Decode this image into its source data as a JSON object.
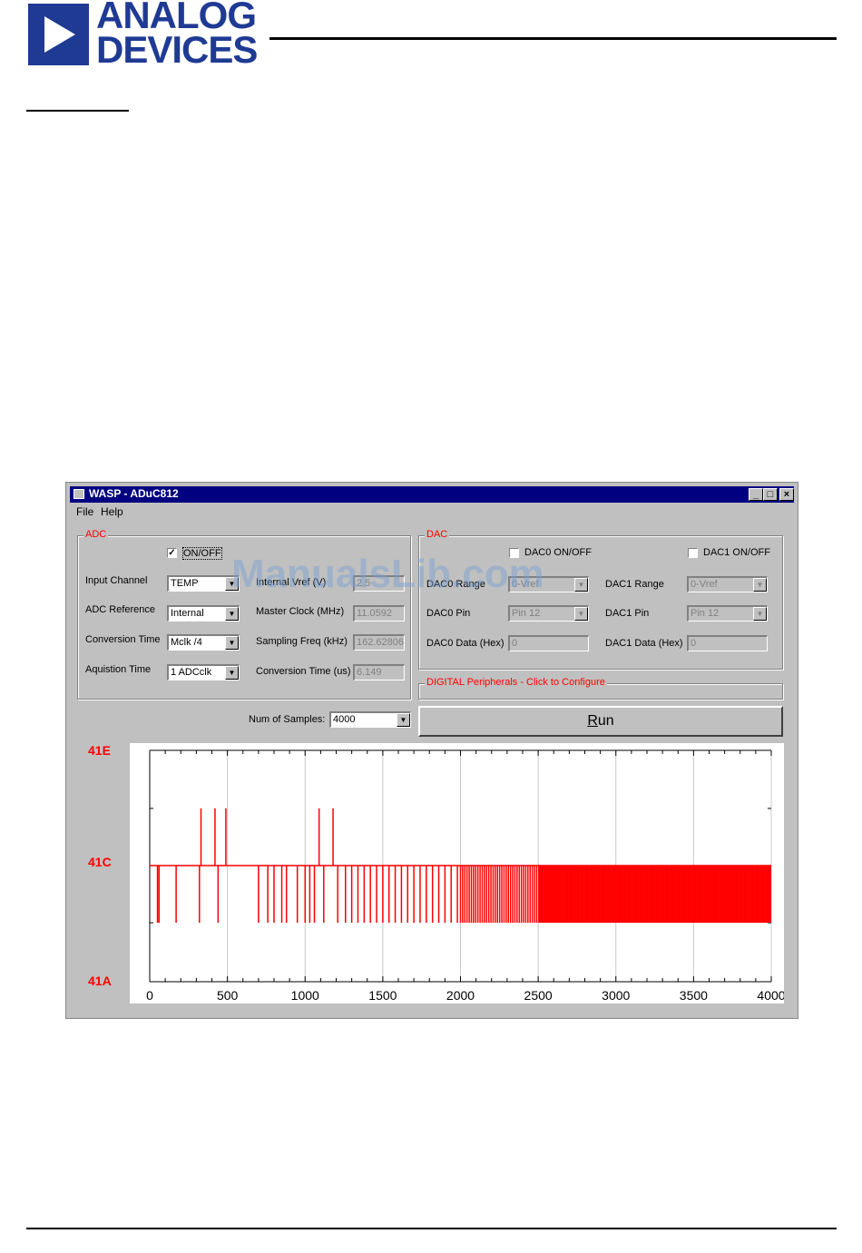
{
  "header": {
    "logo_line1": "ANALOG",
    "logo_line2": "DEVICES",
    "brand_color": "#1f3a93"
  },
  "watermark": "ManualsLib.com",
  "window": {
    "title": "WASP - ADuC812",
    "buttons": [
      "_",
      "□",
      "×"
    ],
    "menu": [
      "File",
      "Help"
    ]
  },
  "adc": {
    "legend": "ADC",
    "onoff_label": "ON/OFF",
    "onoff_checked": true,
    "rows": [
      {
        "label": "Input Channel",
        "value": "TEMP"
      },
      {
        "label": "ADC Reference",
        "value": "Internal"
      },
      {
        "label": "Conversion Time",
        "value": "Mclk /4"
      },
      {
        "label": "Aquistion Time",
        "value": "1 ADCclk"
      }
    ],
    "right_rows": [
      {
        "label": "Internal Vref (V)",
        "value": "2.5"
      },
      {
        "label": "Master Clock (MHz)",
        "value": "11.0592"
      },
      {
        "label": "Sampling Freq (kHz)",
        "value": "162.62806"
      },
      {
        "label": "Conversion Time (us)",
        "value": "6.149"
      }
    ]
  },
  "dac": {
    "legend": "DAC",
    "dac0_onoff": "DAC0 ON/OFF",
    "dac1_onoff": "DAC1 ON/OFF",
    "dac0_range_label": "DAC0 Range",
    "dac0_range": "0-Vref",
    "dac1_range_label": "DAC1 Range",
    "dac1_range": "0-Vref",
    "dac0_pin_label": "DAC0 Pin",
    "dac0_pin": "Pin 12",
    "dac1_pin_label": "DAC1 Pin",
    "dac1_pin": "Pin 12",
    "dac0_data_label": "DAC0 Data (Hex)",
    "dac0_data": "0",
    "dac1_data_label": "DAC1 Data (Hex)",
    "dac1_data": "0"
  },
  "digital": {
    "legend": "DIGITAL Peripherals - Click to Configure"
  },
  "samples": {
    "label": "Num of Samples:",
    "value": "4000"
  },
  "run": {
    "label": "Run",
    "accel": "R",
    "rest": "un"
  },
  "chart_data": {
    "type": "line",
    "xlim": [
      0,
      4000
    ],
    "x_ticks": [
      "0",
      "500",
      "1000",
      "1500",
      "2000",
      "2500",
      "3000",
      "3500",
      "4000"
    ],
    "y_ticks": [
      "41E",
      "41C",
      "41A"
    ],
    "baseline": "41C",
    "series_color": "#ff0000",
    "series": [
      {
        "levels": [
          "41B",
          "41C",
          "41D"
        ],
        "spikes_up_41D": [
          330,
          420,
          490,
          1090,
          1180
        ],
        "spikes_down_41B": [
          50,
          60,
          170,
          320,
          440,
          700,
          760,
          800,
          850,
          880,
          950,
          1000,
          1030,
          1060,
          1120,
          1210,
          1260,
          1300,
          1340,
          1380,
          1420,
          1460,
          1500,
          1540,
          1580,
          1620,
          1660,
          1700,
          1740,
          1780,
          1820,
          1860,
          1900,
          1940,
          1980
        ]
      }
    ],
    "dense_region_from": 2000,
    "dense_region_to": 4000
  }
}
